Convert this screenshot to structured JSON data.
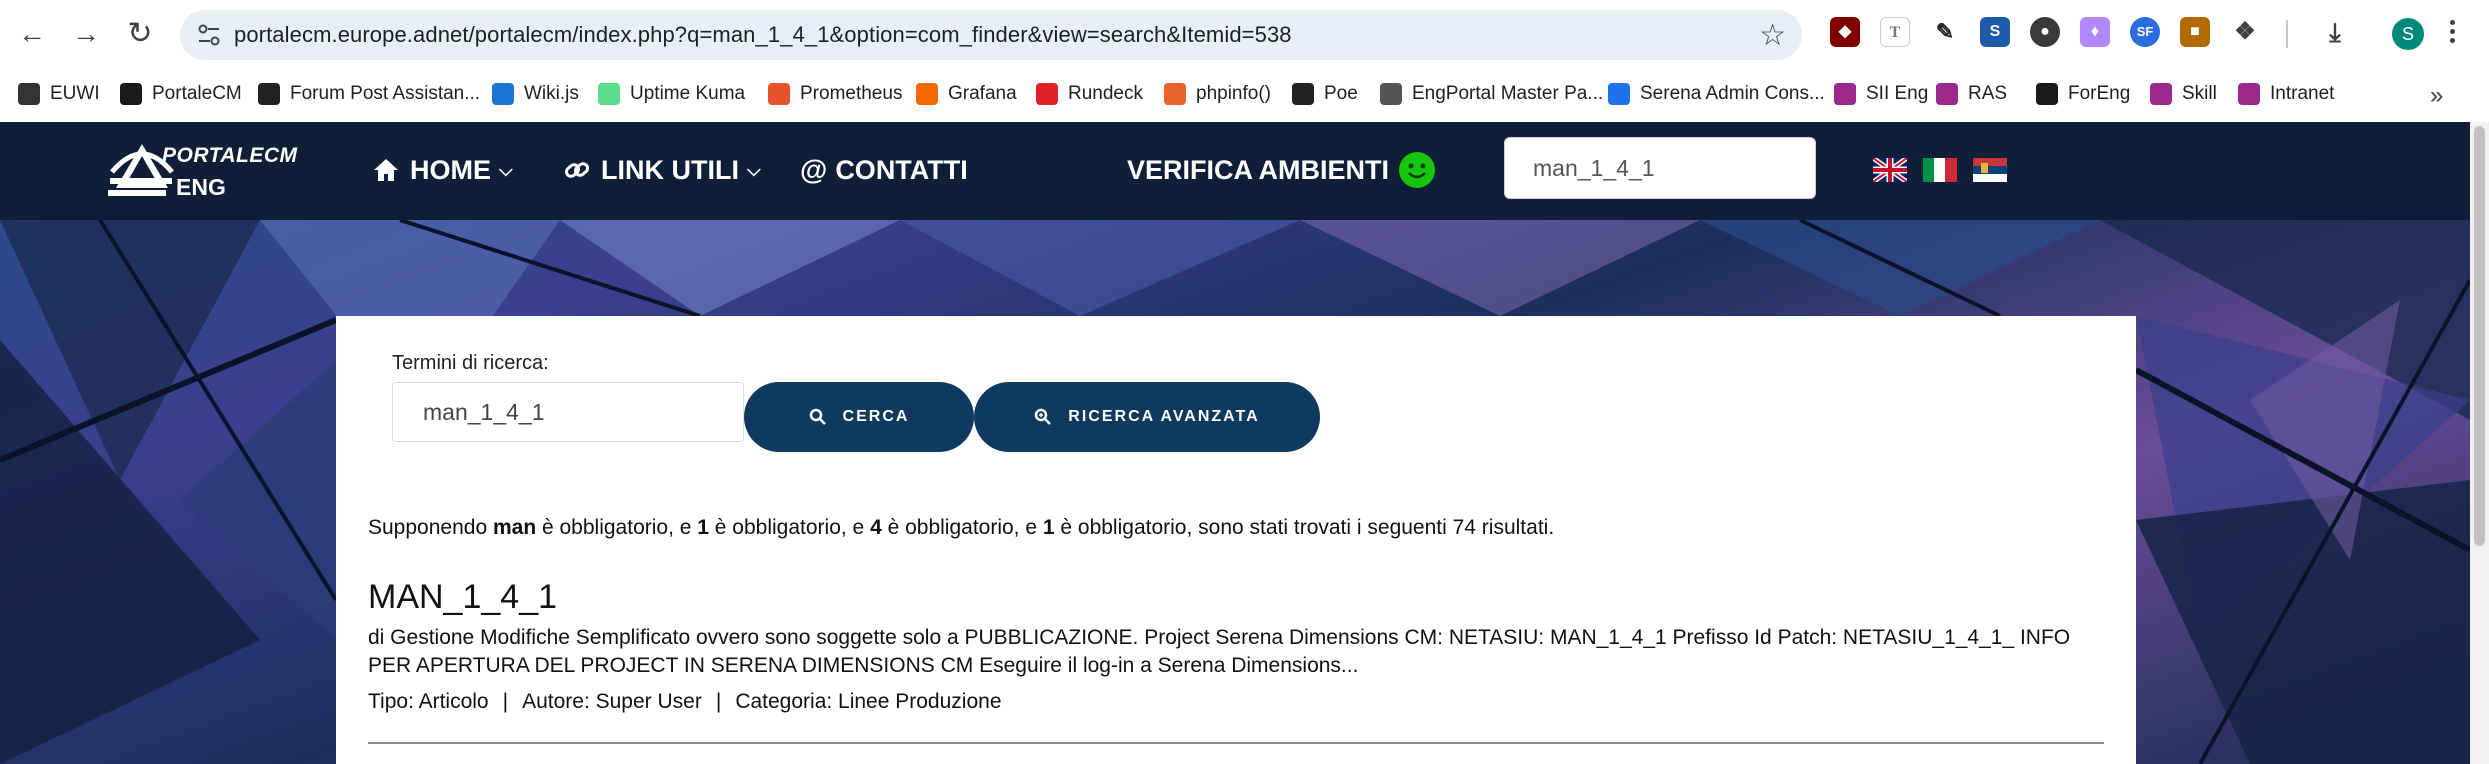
{
  "browser": {
    "url": "portalecm.europe.adnet/portalecm/index.php?q=man_1_4_1&option=com_finder&view=search&Itemid=538",
    "profile_initial": "S",
    "bookmarks": [
      {
        "label": "EUWI",
        "icon": "euwi-icon",
        "color": "#333333"
      },
      {
        "label": "PortaleCM",
        "icon": "portalecm-icon",
        "color": "#1a1a1a"
      },
      {
        "label": "Forum Post Assistan...",
        "icon": "joomla-icon",
        "color": "#222222"
      },
      {
        "label": "Wiki.js",
        "icon": "wikijs-icon",
        "color": "#1976d2"
      },
      {
        "label": "Uptime Kuma",
        "icon": "uptime-kuma-icon",
        "color": "#5cdd8b"
      },
      {
        "label": "Prometheus",
        "icon": "prometheus-icon",
        "color": "#e6522c"
      },
      {
        "label": "Grafana",
        "icon": "grafana-icon",
        "color": "#f46800"
      },
      {
        "label": "Rundeck",
        "icon": "rundeck-icon",
        "color": "#e0212a"
      },
      {
        "label": "phpinfo()",
        "icon": "phpinfo-icon",
        "color": "#e8622c"
      },
      {
        "label": "Poe",
        "icon": "poe-icon",
        "color": "#222222"
      },
      {
        "label": "EngPortal Master Pa...",
        "icon": "globe-icon",
        "color": "#555555"
      },
      {
        "label": "Serena Admin Cons...",
        "icon": "serena-icon",
        "color": "#1e73e8"
      },
      {
        "label": "SII Eng",
        "icon": "sii-eng-icon",
        "color": "#9c2a8c"
      },
      {
        "label": "RAS",
        "icon": "ras-icon",
        "color": "#9c2a8c"
      },
      {
        "label": "ForEng",
        "icon": "foreng-icon",
        "color": "#1a1a1a"
      },
      {
        "label": "Skill",
        "icon": "skill-icon",
        "color": "#9c2a8c"
      },
      {
        "label": "Intranet",
        "icon": "intranet-icon",
        "color": "#9c2a8c"
      }
    ]
  },
  "site": {
    "logo_top": "PORTALECM",
    "logo_bottom": "ENG",
    "menu": {
      "home": "HOME",
      "links": "LINK UTILI",
      "contacts": "CONTATTI",
      "verify": "VERIFICA AMBIENTI"
    },
    "header_search_value": "man_1_4_1",
    "languages": [
      "English",
      "Italiano",
      "Srpski"
    ],
    "colors": {
      "header": "#0f1f38",
      "button": "#0f3a5f",
      "status_ok": "#16c60c"
    }
  },
  "search": {
    "label": "Termini di ricerca:",
    "value": "man_1_4_1",
    "search_button": "CERCA",
    "advanced_button": "RICERCA AVANZATA",
    "summary": {
      "prefix": "Supponendo ",
      "t1": "man",
      "mid1": " è obbligatorio, e ",
      "t2": "1",
      "mid2": " è obbligatorio, e ",
      "t3": "4",
      "mid3": " è obbligatorio, e ",
      "t4": "1",
      "suffix": " è obbligatorio, sono stati trovati i seguenti 74 risultati."
    }
  },
  "results": [
    {
      "title": "MAN_1_4_1",
      "excerpt": "di Gestione Modifiche Semplificato ovvero sono soggette solo a PUBBLICAZIONE. Project Serena Dimensions CM: NETASIU: MAN_1_4_1 Prefisso Id Patch: NETASIU_1_4_1_ INFO PER APERTURA DEL PROJECT IN SERENA DIMENSIONS CM Eseguire il log-in a Serena Dimensions...",
      "type": "Tipo: Articolo",
      "author": "Autore: Super User",
      "category": "Categoria: Linee Produzione",
      "sep": "|"
    }
  ]
}
